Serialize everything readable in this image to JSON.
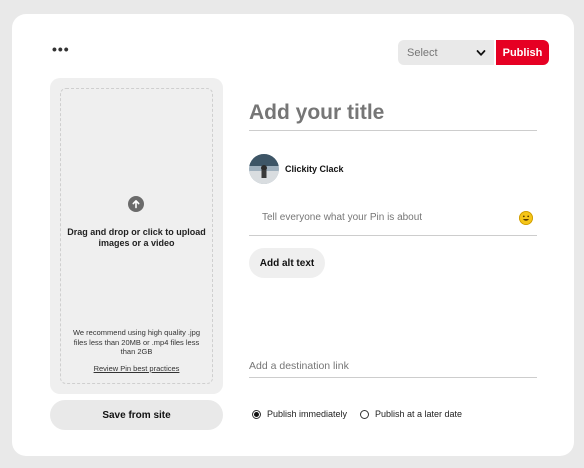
{
  "toolbar": {
    "more_label": "•••",
    "select_label": "Select",
    "publish_label": "Publish"
  },
  "upload": {
    "instruction": "Drag and drop or click to upload images or a video",
    "recommendation": "We recommend using high quality .jpg files less than 20MB or .mp4 files less than 2GB",
    "review_link": "Review Pin best practices"
  },
  "save_from_site_label": "Save from site",
  "form": {
    "title_placeholder": "Add your title",
    "username": "Clickity Clack",
    "description_placeholder": "Tell everyone what your Pin is about",
    "alt_text_label": "Add alt text",
    "destination_placeholder": "Add a destination link"
  },
  "publish_options": {
    "immediately_label": "Publish immediately",
    "later_label": "Publish at a later date",
    "selected": "immediately"
  },
  "colors": {
    "accent": "#e60023",
    "background": "#e9e9e9"
  },
  "icons": {
    "more": "more-dots-icon",
    "dropdown": "chevron-down-icon",
    "upload": "upload-arrow-icon",
    "emoji": "emoji-smiley-icon"
  }
}
